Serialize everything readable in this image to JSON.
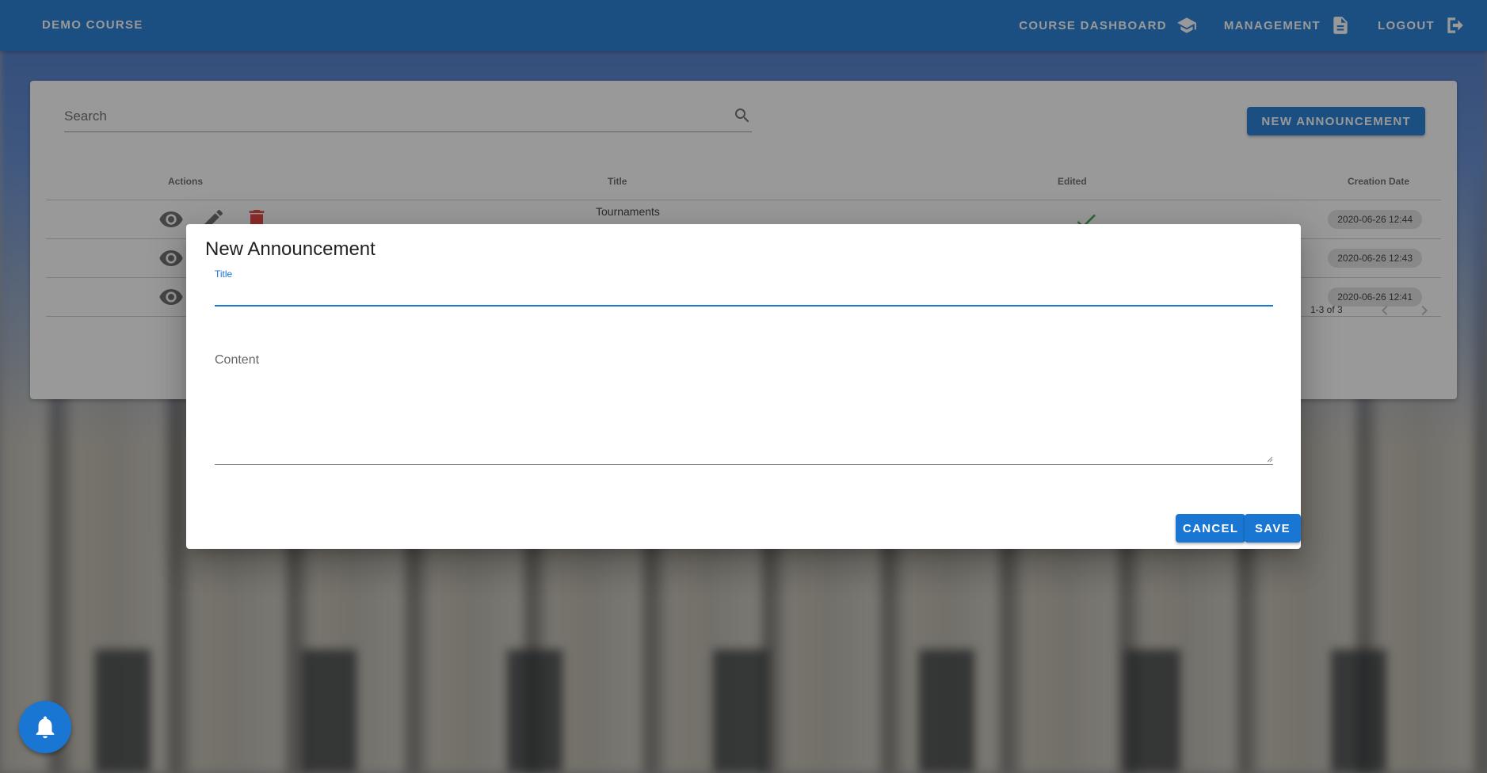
{
  "appbar": {
    "course_name": "DEMO COURSE",
    "nav": [
      {
        "label": "COURSE DASHBOARD",
        "icon": "school-icon"
      },
      {
        "label": "MANAGEMENT",
        "icon": "document-icon"
      },
      {
        "label": "LOGOUT",
        "icon": "logout-icon"
      }
    ],
    "color": "#1976d2"
  },
  "announcements": {
    "search_placeholder": "Search",
    "new_button": "NEW ANNOUNCEMENT",
    "columns": [
      "Actions",
      "Title",
      "Edited",
      "Creation Date"
    ],
    "rows": [
      {
        "title": "Tournaments",
        "edited": true,
        "created": "2020-06-26 12:44"
      },
      {
        "title": "",
        "edited": null,
        "created": "2020-06-26 12:43"
      },
      {
        "title": "",
        "edited": null,
        "created": "2020-06-26 12:41"
      }
    ],
    "pagination": "1-3 of 3"
  },
  "dialog": {
    "title": "New Announcement",
    "title_label": "Title",
    "title_value": "",
    "content_label": "Content",
    "content_value": "",
    "cancel": "CANCEL",
    "save": "SAVE"
  },
  "colors": {
    "primary": "#1976d2",
    "delete": "#e53935",
    "edited": "#3fa441"
  }
}
